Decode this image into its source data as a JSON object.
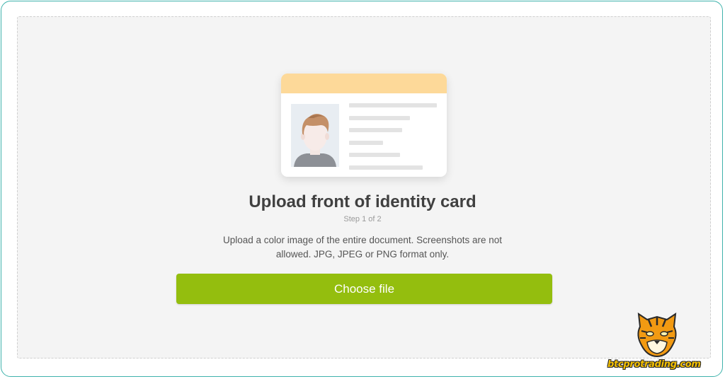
{
  "upload": {
    "title": "Upload front of identity card",
    "step": "Step 1 of 2",
    "description": "Upload a color image of the entire document. Screenshots are not allowed. JPG, JPEG or PNG format only.",
    "button_label": "Choose file"
  },
  "watermark": {
    "text": "btcprotrading.com"
  },
  "colors": {
    "accent": "#94be0e",
    "card_header": "#fdd999",
    "frame_border": "#3fb3ac"
  },
  "icons": [
    "id-card-illustration",
    "tiger-logo-icon"
  ]
}
